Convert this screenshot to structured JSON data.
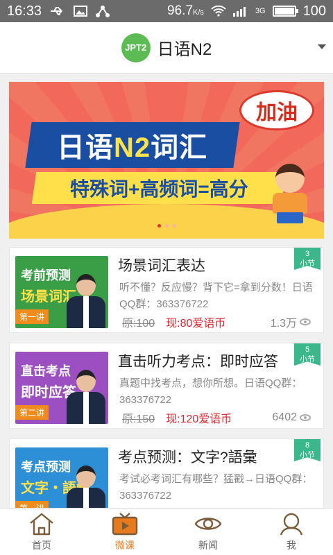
{
  "status_bar": {
    "time": "16:33",
    "battery_percent_text": "96.7",
    "battery_unit": "K/s",
    "network": "3G",
    "battery_level": "100"
  },
  "header": {
    "logo_text": "JPT2",
    "title": "日语N2"
  },
  "banner": {
    "title_a": "日语",
    "title_b": "N2",
    "title_c": "词汇",
    "subtitle": "特殊词+高频词=高分",
    "bubble": "加油"
  },
  "courses": [
    {
      "thumb_line1": "考前预测",
      "thumb_line2": "场景词汇",
      "thumb_lesson": "第一讲",
      "thumb_bg": "#3a9e47",
      "thumb_line2_color": "#ffe14a",
      "sections_count": "3",
      "sections_unit": "小节",
      "title": "场景词汇表达",
      "desc": "听不懂？反应慢？背下它=拿到分数！日语QQ群：363376722",
      "price_original": "原:100",
      "price_now": "现:80爱语币",
      "views": "1.3万"
    },
    {
      "thumb_line1": "直击考点",
      "thumb_line2": "即时应答",
      "thumb_lesson": "第二讲",
      "thumb_bg": "#9b4fc1",
      "thumb_line2_color": "#ffffff",
      "sections_count": "5",
      "sections_unit": "小节",
      "title": "直击听力考点：即时应答",
      "desc": "真题中找考点，想你所想。日语QQ群：363376722",
      "price_original": "原:150",
      "price_now": "现:120爱语币",
      "views": "6402"
    },
    {
      "thumb_line1": "考点预测",
      "thumb_line2": "文字・語彙",
      "thumb_lesson": "第一讲",
      "thumb_bg": "#2d8fd6",
      "thumb_line2_color": "#ffe14a",
      "sections_count": "8",
      "sections_unit": "小节",
      "title": "考点预测：文字?語彙",
      "desc": "考试必考词汇有哪些？猛戳→日语QQ群：363376722",
      "price_original": "",
      "price_now": "",
      "views": ""
    }
  ],
  "tabs": [
    {
      "label": "首页",
      "icon": "home-icon",
      "active": false
    },
    {
      "label": "微课",
      "icon": "tv-icon",
      "active": true
    },
    {
      "label": "新闻",
      "icon": "eye-icon",
      "active": false
    },
    {
      "label": "我",
      "icon": "user-icon",
      "active": false
    }
  ]
}
